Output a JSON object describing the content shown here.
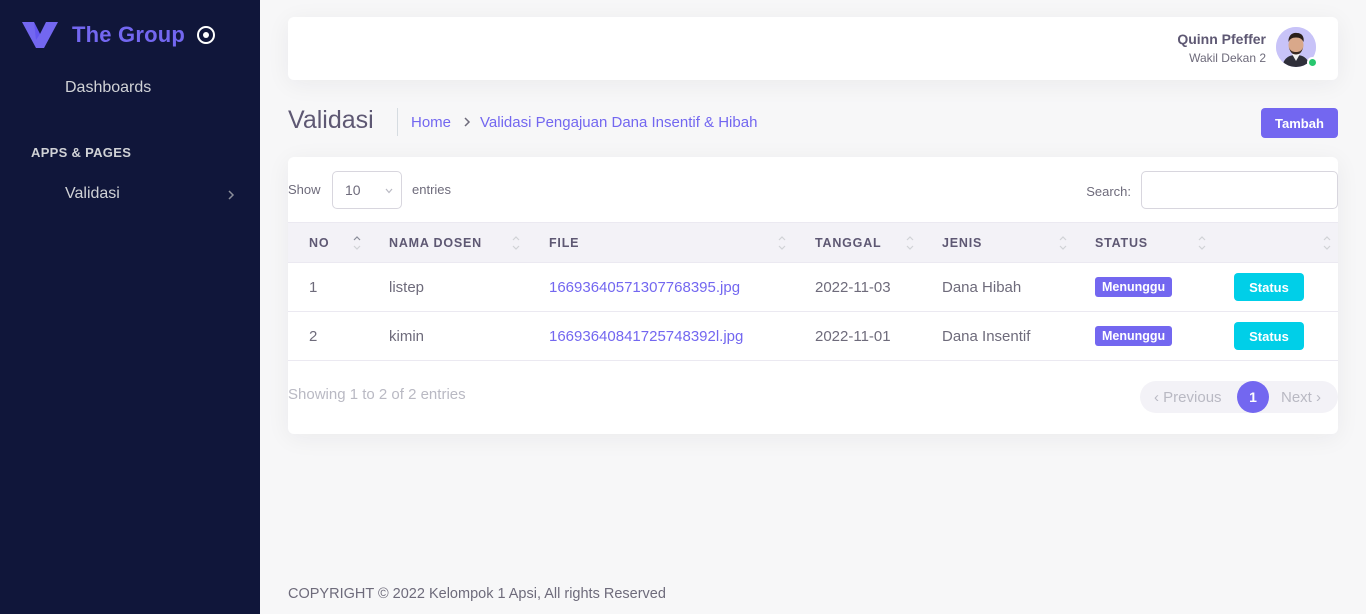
{
  "sidebar": {
    "brand": "The Group",
    "items": [
      {
        "label": "Dashboards"
      },
      {
        "label": "Validasi"
      }
    ],
    "section_header": "APPS & PAGES"
  },
  "navbar": {
    "user_name": "Quinn Pfeffer",
    "user_role": "Wakil Dekan 2"
  },
  "header": {
    "title": "Validasi",
    "breadcrumb": [
      "Home",
      "Validasi Pengajuan Dana Insentif & Hibah"
    ],
    "add_button": "Tambah"
  },
  "table_controls": {
    "show_label": "Show",
    "page_size": "10",
    "entries_label": "entries",
    "search_label": "Search:",
    "search_value": ""
  },
  "table": {
    "columns": [
      "NO",
      "NAMA DOSEN",
      "FILE",
      "TANGGAL",
      "JENIS",
      "STATUS",
      ""
    ],
    "rows": [
      {
        "no": "1",
        "nama": "listep",
        "file": "16693640571307768395.jpg",
        "tanggal": "2022-11-03",
        "jenis": "Dana Hibah",
        "status": "Menunggu",
        "action": "Status"
      },
      {
        "no": "2",
        "nama": "kimin",
        "file": "16693640841725748392l.jpg",
        "tanggal": "2022-11-01",
        "jenis": "Dana Insentif",
        "status": "Menunggu",
        "action": "Status"
      }
    ]
  },
  "pagination": {
    "info": "Showing 1 to 2 of 2 entries",
    "prev": "Previous",
    "current": "1",
    "next": "Next"
  },
  "footer": {
    "text": "COPYRIGHT © 2022 Kelompok 1 Apsi, All rights Reserved"
  },
  "colors": {
    "primary": "#7367f0",
    "info": "#00cfe8",
    "sidebar_bg": "#10163a",
    "online": "#28c76f"
  }
}
